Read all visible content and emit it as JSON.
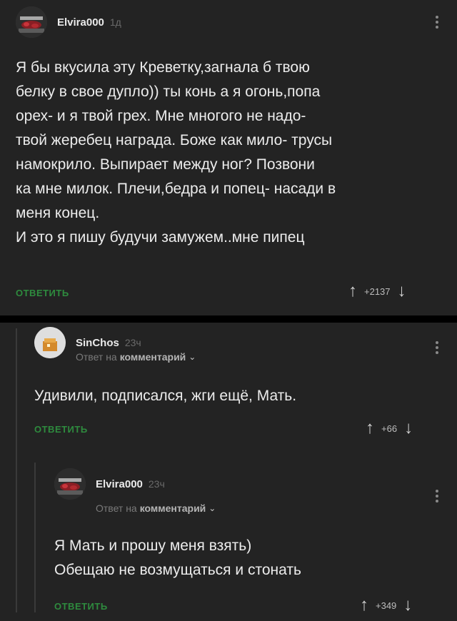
{
  "comment1": {
    "username": "Elvira000",
    "time": "1д",
    "text": "Я бы вкусила эту Креветку,загнала б твою\nбелку в свое дупло)) ты конь а я огонь,попа\nорех- и я твой грех. Мне многого не надо-\nтвой жеребец награда. Боже как мило- трусы\nнамокрило. Выпирает между ног? Позвони\nка мне милок. Плечи,бедра и попец- насади в\nменя конец.\nИ это я пишу будучи замужем..мне пипец",
    "reply_label": "ОТВЕТИТЬ",
    "rating": "+2137"
  },
  "comment2": {
    "username": "SinChos",
    "time": "23ч",
    "reply_prefix": "Ответ на",
    "reply_target": "комментарий",
    "text": "Удивили, подписался, жги ещё, Мать.",
    "reply_label": "ОТВЕТИТЬ",
    "rating": "+66"
  },
  "comment3": {
    "username": "Elvira000",
    "time": "23ч",
    "reply_prefix": "Ответ на",
    "reply_target": "комментарий",
    "text": "Я Мать и прошу меня взять)\nОбещаю не возмущаться и стонать",
    "reply_label": "ОТВЕТИТЬ",
    "rating": "+349"
  },
  "icons": {
    "upvote": "↑",
    "downvote": "↓",
    "expand": "⌄"
  },
  "colors": {
    "background": "#232323",
    "accent_green": "#2e8b3e",
    "separator": "#000000"
  }
}
